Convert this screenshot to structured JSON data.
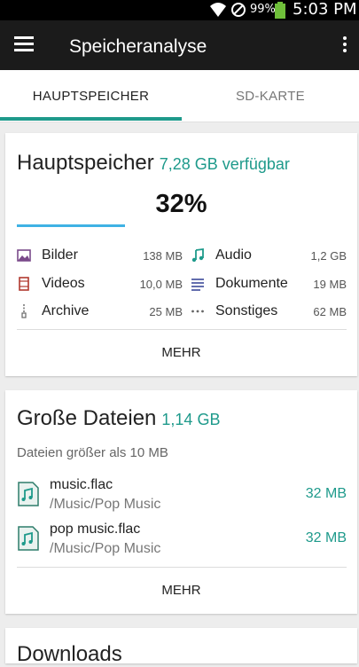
{
  "status": {
    "battery_pct": "99%",
    "time": "5:03 PM"
  },
  "toolbar": {
    "title": "Speicheranalyse"
  },
  "tabs": [
    {
      "label": "HAUPTSPEICHER"
    },
    {
      "label": "SD-KARTE"
    }
  ],
  "main_storage": {
    "title": "Hauptspeicher",
    "available": "7,28 GB verfügbar",
    "percent": "32%",
    "used_fraction": 0.32,
    "categories": [
      {
        "icon": "image-icon",
        "label": "Bilder",
        "size": "138 MB"
      },
      {
        "icon": "music-note-icon",
        "label": "Audio",
        "size": "1,2 GB"
      },
      {
        "icon": "film-icon",
        "label": "Videos",
        "size": "10,0 MB"
      },
      {
        "icon": "document-lines-icon",
        "label": "Dokumente",
        "size": "19 MB"
      },
      {
        "icon": "archive-zipper-icon",
        "label": "Archive",
        "size": "25 MB"
      },
      {
        "icon": "ellipsis-icon",
        "label": "Sonstiges",
        "size": "62 MB"
      }
    ],
    "more_label": "MEHR"
  },
  "large_files": {
    "title": "Große Dateien",
    "total": "1,14 GB",
    "description": "Dateien größer als 10 MB",
    "files": [
      {
        "name": "music.flac",
        "path": "/Music/Pop Music",
        "size": "32 MB"
      },
      {
        "name": "pop music.flac",
        "path": "/Music/Pop Music",
        "size": "32 MB"
      }
    ],
    "more_label": "MEHR"
  },
  "third_card": {
    "title": "Downloads"
  },
  "colors": {
    "accent": "#1e9a8b",
    "progress": "#3fb2e4",
    "toolbar": "#1b1b1b"
  }
}
